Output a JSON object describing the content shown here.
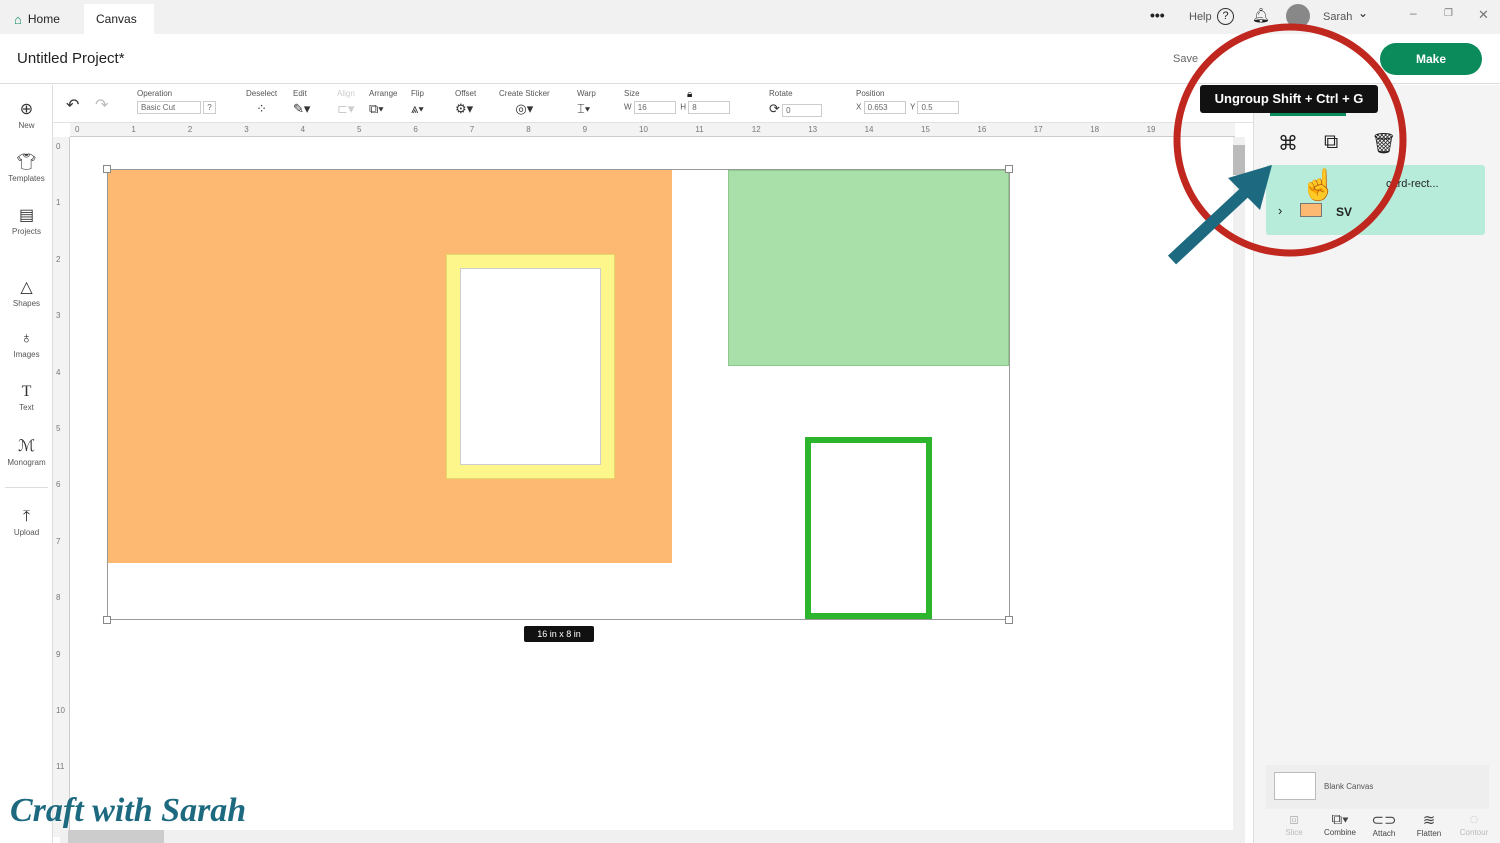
{
  "tabs": [
    {
      "label": "Home",
      "icon": "home-icon"
    },
    {
      "label": "Canvas"
    }
  ],
  "topbar": {
    "more": "•••",
    "help": "Help",
    "user": "Sarah"
  },
  "project": {
    "title": "Untitled Project*",
    "save": "Save",
    "make": "Make"
  },
  "toolbar": {
    "operation_label": "Operation",
    "operation_value": "Basic Cut",
    "operation_help": "?",
    "deselect": "Deselect",
    "edit": "Edit",
    "align": "Align",
    "arrange": "Arrange",
    "flip": "Flip",
    "offset": "Offset",
    "create_sticker": "Create Sticker",
    "warp": "Warp",
    "size_label": "Size",
    "w_label": "W",
    "w_value": "16",
    "h_label": "H",
    "h_value": "8",
    "rotate_label": "Rotate",
    "rotate_value": "0",
    "position_label": "Position",
    "x_label": "X",
    "x_value": "0.653",
    "y_label": "Y",
    "y_value": "0.5"
  },
  "sidebar": {
    "items": [
      {
        "label": "New"
      },
      {
        "label": "Templates"
      },
      {
        "label": "Projects"
      },
      {
        "label": "Shapes"
      },
      {
        "label": "Images"
      },
      {
        "label": "Text"
      },
      {
        "label": "Monogram"
      },
      {
        "label": "Upload"
      }
    ]
  },
  "ruler": {
    "top": [
      "0",
      "1",
      "2",
      "3",
      "4",
      "5",
      "6",
      "7",
      "8",
      "9",
      "10",
      "11",
      "12",
      "13",
      "14",
      "15",
      "16",
      "17",
      "18",
      "19"
    ],
    "left": [
      "0",
      "1",
      "2",
      "3",
      "4",
      "5",
      "6",
      "7",
      "8",
      "9",
      "10",
      "11"
    ]
  },
  "canvas": {
    "size_label": "16 in x 8 in",
    "colors": {
      "orange": "#fdb872",
      "yellow": "#fdf68b",
      "light_green": "#a9dfa8",
      "green": "#2db52d"
    }
  },
  "panel": {
    "tooltip": "Ungroup Shift + Ctrl + G",
    "layer_name": "card-rect...",
    "group_name": "SV",
    "blank_canvas": "Blank Canvas",
    "bottom": [
      {
        "label": "Slice"
      },
      {
        "label": "Combine"
      },
      {
        "label": "Attach"
      },
      {
        "label": "Flatten"
      },
      {
        "label": "Contour"
      }
    ]
  },
  "watermark": "Craft with Sarah",
  "colors": {
    "brand": "#0b8a5b",
    "highlight_ring": "#c0271f",
    "arrow": "#1d6a80",
    "layer_selected": "#b6ecd9"
  }
}
